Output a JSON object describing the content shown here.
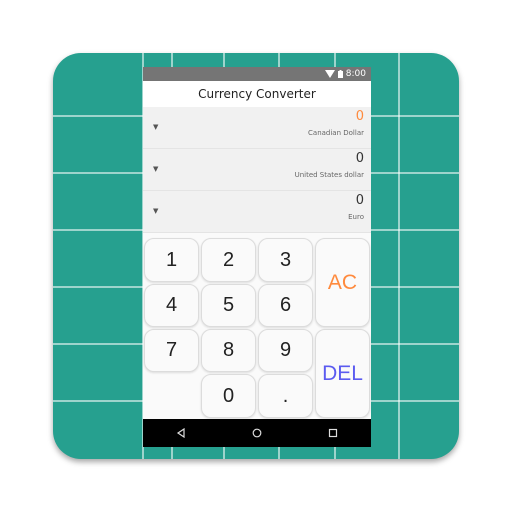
{
  "status_bar": {
    "time": "8:00",
    "icons": [
      "wifi-icon",
      "battery-icon"
    ]
  },
  "app": {
    "title": "Currency Converter"
  },
  "currencies": [
    {
      "value": "0",
      "name": "Canadian Dollar",
      "active": true
    },
    {
      "value": "0",
      "name": "United States dollar",
      "active": false
    },
    {
      "value": "0",
      "name": "Euro",
      "active": false
    }
  ],
  "keypad": {
    "k1": "1",
    "k2": "2",
    "k3": "3",
    "k4": "4",
    "k5": "5",
    "k6": "6",
    "k7": "7",
    "k8": "8",
    "k9": "9",
    "k0": "0",
    "dot": ".",
    "ac": "AC",
    "del": "DEL"
  },
  "nav": {
    "icons": [
      "back-icon",
      "home-icon",
      "recents-icon"
    ]
  },
  "colors": {
    "icon_background": "#26a08f",
    "accent_orange": "#ff8a3d",
    "accent_blue": "#5b5bf0",
    "status_bar": "#757575"
  }
}
